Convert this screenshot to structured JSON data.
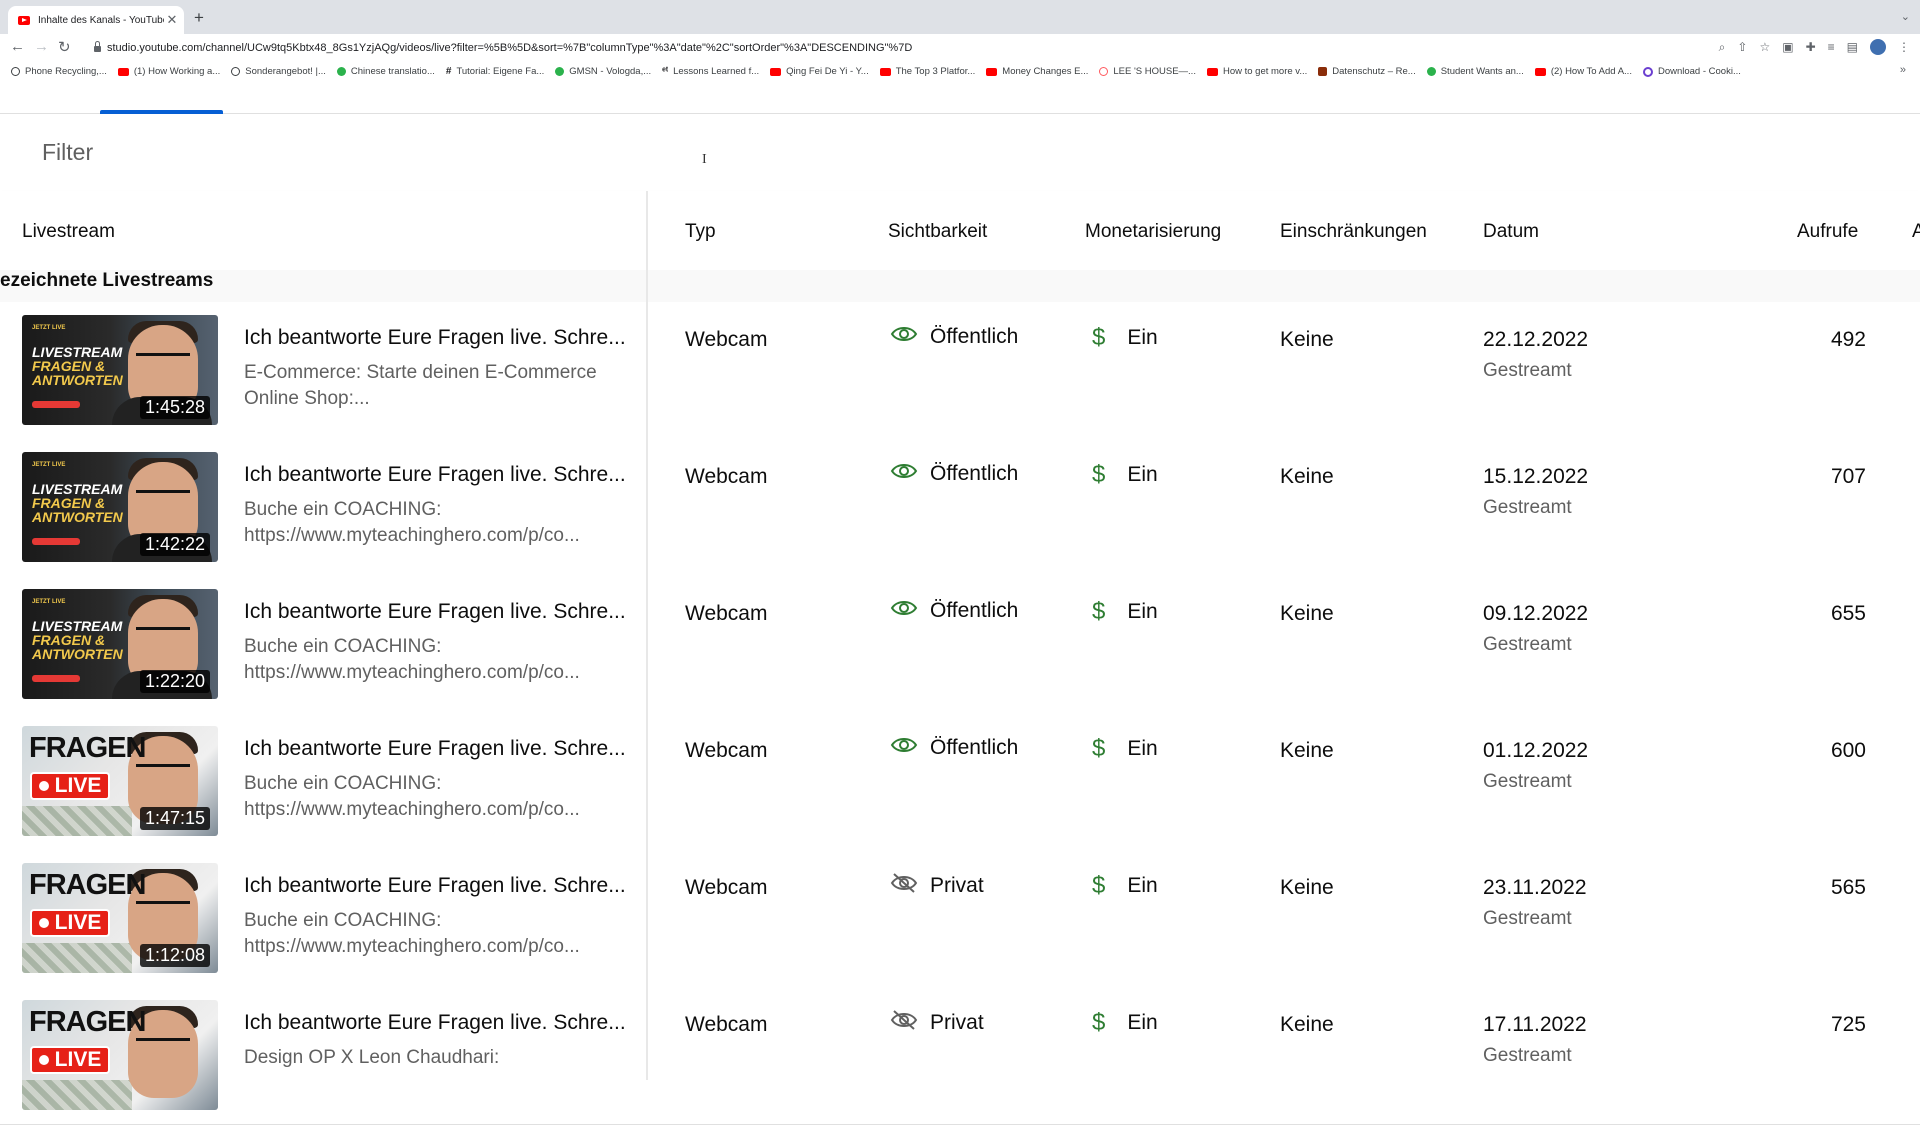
{
  "browser": {
    "tab_title": "Inhalte des Kanals - YouTube S",
    "url": "studio.youtube.com/channel/UCw9tq5Kbtx48_8Gs1YzjAQg/videos/live?filter=%5B%5D&sort=%7B\"columnType\"%3A\"date\"%2C\"sortOrder\"%3A\"DESCENDING\"%7D",
    "bookmarks": [
      {
        "label": "Phone Recycling,...",
        "icon": "circle-icon"
      },
      {
        "label": "(1) How Working a...",
        "icon": "youtube-icon"
      },
      {
        "label": "Sonderangebot! |...",
        "icon": "circle-icon"
      },
      {
        "label": "Chinese translatio...",
        "icon": "green-icon"
      },
      {
        "label": "Tutorial: Eigene Fa...",
        "icon": "hash-icon"
      },
      {
        "label": "GMSN - Vologda,...",
        "icon": "green-icon"
      },
      {
        "label": "Lessons Learned f...",
        "icon": "text-icon"
      },
      {
        "label": "Qing Fei De Yi - Y...",
        "icon": "youtube-icon"
      },
      {
        "label": "The Top 3 Platfor...",
        "icon": "youtube-icon"
      },
      {
        "label": "Money Changes E...",
        "icon": "youtube-icon"
      },
      {
        "label": "LEE 'S HOUSE—...",
        "icon": "airbnb-icon"
      },
      {
        "label": "How to get more v...",
        "icon": "youtube-icon"
      },
      {
        "label": "Datenschutz – Re...",
        "icon": "dark-icon"
      },
      {
        "label": "Student Wants an...",
        "icon": "green-icon"
      },
      {
        "label": "(2) How To Add A...",
        "icon": "youtube-icon"
      },
      {
        "label": "Download - Cooki...",
        "icon": "purple-icon"
      }
    ]
  },
  "filter": {
    "placeholder": "Filter"
  },
  "columns": {
    "livestream": "Livestream",
    "typ": "Typ",
    "sichtbarkeit": "Sichtbarkeit",
    "monetarisierung": "Monetarisierung",
    "einschraenkungen": "Einschränkungen",
    "datum": "Datum",
    "aufrufe": "Aufrufe",
    "extra": "A"
  },
  "section_label": "ezeichnete Livestreams",
  "rows": [
    {
      "title": "Ich beantworte Eure Fragen live. Schre...",
      "desc": "E-Commerce: Starte deinen E-Commerce\nOnline Shop:...",
      "duration": "1:45:28",
      "type": "Webcam",
      "visibility": "Öffentlich",
      "visibility_icon": "eye-icon",
      "monetization": "Ein",
      "restrictions": "Keine",
      "date": "22.12.2022",
      "date_sub": "Gestreamt",
      "views": "492",
      "thumb": "livestream"
    },
    {
      "title": "Ich beantworte Eure Fragen live. Schre...",
      "desc": "Buche ein COACHING:\nhttps://www.myteachinghero.com/p/co...",
      "duration": "1:42:22",
      "type": "Webcam",
      "visibility": "Öffentlich",
      "visibility_icon": "eye-icon",
      "monetization": "Ein",
      "restrictions": "Keine",
      "date": "15.12.2022",
      "date_sub": "Gestreamt",
      "views": "707",
      "thumb": "livestream"
    },
    {
      "title": "Ich beantworte Eure Fragen live. Schre...",
      "desc": "Buche ein COACHING:\nhttps://www.myteachinghero.com/p/co...",
      "duration": "1:22:20",
      "type": "Webcam",
      "visibility": "Öffentlich",
      "visibility_icon": "eye-icon",
      "monetization": "Ein",
      "restrictions": "Keine",
      "date": "09.12.2022",
      "date_sub": "Gestreamt",
      "views": "655",
      "thumb": "livestream"
    },
    {
      "title": "Ich beantworte Eure Fragen live. Schre...",
      "desc": "Buche ein COACHING:\nhttps://www.myteachinghero.com/p/co...",
      "duration": "1:47:15",
      "type": "Webcam",
      "visibility": "Öffentlich",
      "visibility_icon": "eye-icon",
      "monetization": "Ein",
      "restrictions": "Keine",
      "date": "01.12.2022",
      "date_sub": "Gestreamt",
      "views": "600",
      "thumb": "fragen"
    },
    {
      "title": "Ich beantworte Eure Fragen live. Schre...",
      "desc": "Buche ein COACHING:\nhttps://www.myteachinghero.com/p/co...",
      "duration": "1:12:08",
      "type": "Webcam",
      "visibility": "Privat",
      "visibility_icon": "eye-off-icon",
      "monetization": "Ein",
      "restrictions": "Keine",
      "date": "23.11.2022",
      "date_sub": "Gestreamt",
      "views": "565",
      "thumb": "fragen"
    },
    {
      "title": "Ich beantworte Eure Fragen live. Schre...",
      "desc": "Design OP X Leon Chaudhari:",
      "duration": "",
      "type": "Webcam",
      "visibility": "Privat",
      "visibility_icon": "eye-off-icon",
      "monetization": "Ein",
      "restrictions": "Keine",
      "date": "17.11.2022",
      "date_sub": "Gestreamt",
      "views": "725",
      "thumb": "fragen"
    }
  ],
  "thumb_text": {
    "small": "JETZT LIVE",
    "line1": "LIVESTREAM",
    "line2": "FRAGEN &",
    "line3": "ANTWORTEN",
    "fragen": "FRAGEN",
    "live": "LIVE"
  },
  "colors": {
    "accent": "#065fd4",
    "money": "#2e7d32",
    "visibility_icon": "#2e7d32"
  }
}
